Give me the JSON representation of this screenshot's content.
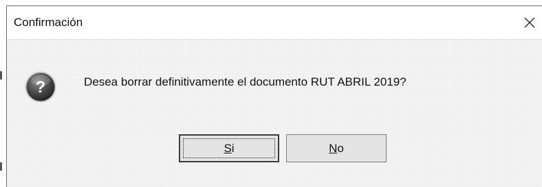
{
  "dialog": {
    "title": "Confirmación",
    "close_icon": "close-icon",
    "message_icon": "question-icon",
    "message": "Desea borrar definitivamente el documento RUT ABRIL 2019?",
    "buttons": {
      "yes": {
        "mnemonic": "S",
        "rest": "i"
      },
      "no": {
        "mnemonic": "N",
        "rest": "o"
      }
    }
  }
}
